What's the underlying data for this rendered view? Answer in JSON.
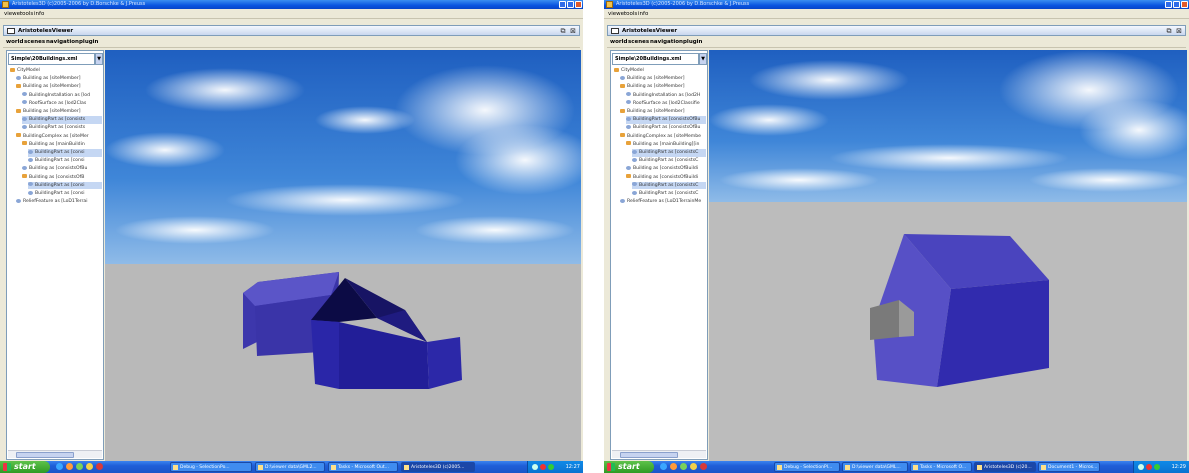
{
  "window": {
    "title": "Aristoteles3D (c)2005-2006 by D.Borschke & J.Preuss",
    "menu": [
      "viewer",
      "tools",
      "info"
    ]
  },
  "viewer": {
    "title": "AristotelesViewer",
    "menu": [
      "world",
      "scenes",
      "navigation",
      "plugin"
    ],
    "file": "Simple\\20Buildings.xml"
  },
  "tree_left": [
    {
      "label": "CityModel",
      "type": "folder",
      "depth": 0,
      "selected": false
    },
    {
      "label": "Building as [siteMember]",
      "type": "leaf",
      "depth": 1,
      "selected": false
    },
    {
      "label": "Building as [siteMember]",
      "type": "folder",
      "depth": 1,
      "selected": false
    },
    {
      "label": "BuildingInstallation as [lod",
      "type": "leaf",
      "depth": 2,
      "selected": false
    },
    {
      "label": "RoofSurface as [lod2Clas",
      "type": "leaf",
      "depth": 2,
      "selected": false
    },
    {
      "label": "Building as [siteMember]",
      "type": "folder",
      "depth": 1,
      "selected": false
    },
    {
      "label": "BuildingPart as [consists",
      "type": "leaf",
      "depth": 2,
      "selected": true
    },
    {
      "label": "BuildingPart as [consists",
      "type": "leaf",
      "depth": 2,
      "selected": false
    },
    {
      "label": "BuildingComplex as [siteMer",
      "type": "folder",
      "depth": 1,
      "selected": false
    },
    {
      "label": "Building as [mainBuildin",
      "type": "folder",
      "depth": 2,
      "selected": false
    },
    {
      "label": "BuildingPart as [consi",
      "type": "leaf",
      "depth": 3,
      "selected": true
    },
    {
      "label": "BuildingPart as [consi",
      "type": "leaf",
      "depth": 3,
      "selected": false
    },
    {
      "label": "Building as [consistsOfBu",
      "type": "leaf",
      "depth": 2,
      "selected": false
    },
    {
      "label": "Building as [consistsOfB",
      "type": "folder",
      "depth": 2,
      "selected": false
    },
    {
      "label": "BuildingPart as [consi",
      "type": "leaf",
      "depth": 3,
      "selected": true
    },
    {
      "label": "BuildingPart as [consi",
      "type": "leaf",
      "depth": 3,
      "selected": false
    },
    {
      "label": "ReliefFeature as [LoD1Terrai",
      "type": "leaf",
      "depth": 1,
      "selected": false
    }
  ],
  "tree_right": [
    {
      "label": "CityModel",
      "type": "folder",
      "depth": 0,
      "selected": false
    },
    {
      "label": "Building as [siteMember]",
      "type": "leaf",
      "depth": 1,
      "selected": false
    },
    {
      "label": "Building as [siteMember]",
      "type": "folder",
      "depth": 1,
      "selected": false
    },
    {
      "label": "BuildingInstallation as [lod2H",
      "type": "leaf",
      "depth": 2,
      "selected": false
    },
    {
      "label": "RoofSurface as [lod2Classifie",
      "type": "leaf",
      "depth": 2,
      "selected": false
    },
    {
      "label": "Building as [siteMember]",
      "type": "folder",
      "depth": 1,
      "selected": false
    },
    {
      "label": "BuildingPart as [consistsOfBu",
      "type": "leaf",
      "depth": 2,
      "selected": true
    },
    {
      "label": "BuildingPart as [consistsOfBu",
      "type": "leaf",
      "depth": 2,
      "selected": false
    },
    {
      "label": "BuildingComplex as [siteMembe",
      "type": "folder",
      "depth": 1,
      "selected": false
    },
    {
      "label": "Building as [mainBuilding][in",
      "type": "folder",
      "depth": 2,
      "selected": false
    },
    {
      "label": "BuildingPart as [consistsC",
      "type": "leaf",
      "depth": 3,
      "selected": true
    },
    {
      "label": "BuildingPart as [consistsC",
      "type": "leaf",
      "depth": 3,
      "selected": false
    },
    {
      "label": "Building as [consistsOfBuildi",
      "type": "leaf",
      "depth": 2,
      "selected": false
    },
    {
      "label": "Building as [consistsOfBuildi",
      "type": "folder",
      "depth": 2,
      "selected": false
    },
    {
      "label": "BuildingPart as [consistsC",
      "type": "leaf",
      "depth": 3,
      "selected": true
    },
    {
      "label": "BuildingPart as [consistsC",
      "type": "leaf",
      "depth": 3,
      "selected": false
    },
    {
      "label": "ReliefFeature as [LoD1TerrainMe",
      "type": "leaf",
      "depth": 1,
      "selected": false
    }
  ],
  "taskbar_left": {
    "start": "start",
    "tasks": [
      "Debug - SelectionPo...",
      "D:\\viewer data\\GML2...",
      "Tasks - Microsoft Out...",
      "Aristoteles3D (c)2005..."
    ],
    "clock": "12:27"
  },
  "taskbar_right": {
    "start": "start",
    "tasks": [
      "Debug - SelectionPl...",
      "D:\\viewer data\\GML...",
      "Tasks - Microsoft O...",
      "Aristoteles3D (c)20...",
      "Document1 - Micros..."
    ],
    "clock": "12:29"
  },
  "colors": {
    "sky_top": "#1f5fc0",
    "ground": "#b9b9b9",
    "building": "#4b45c0",
    "building_dark": "#1f1b80",
    "roof_dark": "#0c0b45",
    "installation": "#808080"
  },
  "icons": [
    "minimize-icon",
    "maximize-icon",
    "close-icon",
    "restore-icon",
    "combo-arrow-icon",
    "folder-icon",
    "leaf-icon",
    "windows-flag-icon"
  ]
}
